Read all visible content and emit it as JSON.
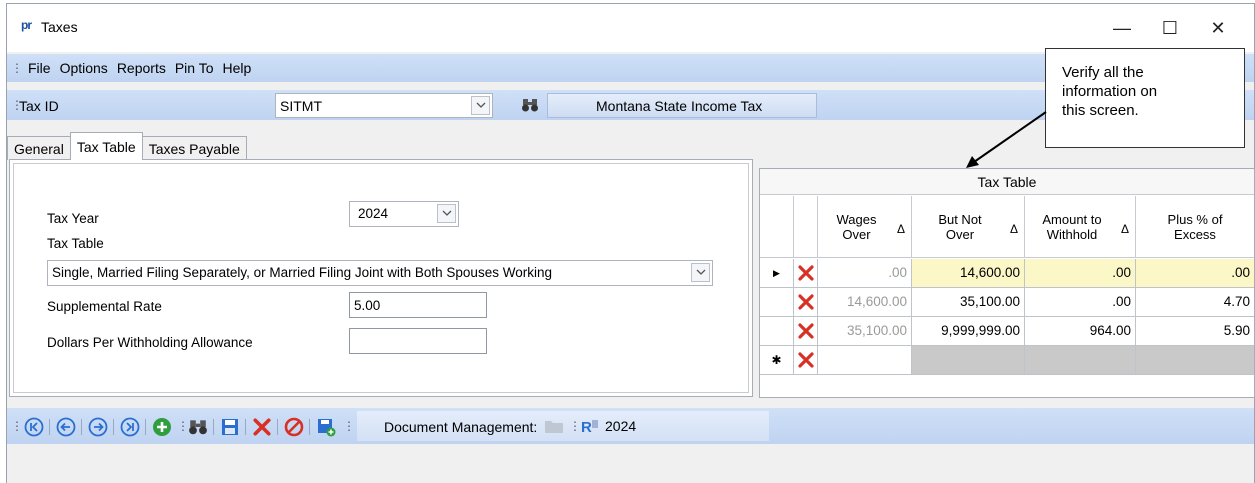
{
  "window": {
    "title": "Taxes",
    "logo": "pr",
    "minimize": "—",
    "maximize": "☐",
    "close": "✕"
  },
  "menu": [
    "File",
    "Options",
    "Reports",
    "Pin To",
    "Help"
  ],
  "tax_id": {
    "label": "Tax ID",
    "value": "SITMT",
    "description": "Montana State Income Tax"
  },
  "callout": {
    "line1": "Verify all the",
    "line2": "information on",
    "line3": "this screen."
  },
  "tabs": [
    "General",
    "Tax Table",
    "Taxes Payable"
  ],
  "active_tab": "Tax Table",
  "form": {
    "tax_year_label": "Tax Year",
    "tax_year_value": "2024",
    "tax_table_label": "Tax Table",
    "tax_table_value": "Single, Married Filing Separately, or Married Filing Joint with Both Spouses Working",
    "supplemental_rate_label": "Supplemental Rate",
    "supplemental_rate_value": "5.00",
    "dollars_allowance_label": "Dollars Per Withholding Allowance",
    "dollars_allowance_value": ""
  },
  "grid": {
    "title": "Tax Table",
    "columns": [
      {
        "line1": "Wages",
        "line2": "Over",
        "sort": "Δ"
      },
      {
        "line1": "But Not",
        "line2": "Over",
        "sort": "Δ"
      },
      {
        "line1": "Amount to",
        "line2": "Withhold",
        "sort": "Δ"
      },
      {
        "line1": "Plus % of",
        "line2": "Excess",
        "sort": ""
      }
    ],
    "rows": [
      {
        "wages_over": ".00",
        "but_not_over": "14,600.00",
        "amount": ".00",
        "percent": ".00"
      },
      {
        "wages_over": "14,600.00",
        "but_not_over": "35,100.00",
        "amount": ".00",
        "percent": "4.70"
      },
      {
        "wages_over": "35,100.00",
        "but_not_over": "9,999,999.00",
        "amount": "964.00",
        "percent": "5.90"
      }
    ],
    "current_row_marker": "▶",
    "new_row_marker": "✱"
  },
  "bottom": {
    "doc_label": "Document Management:",
    "year": "2024"
  },
  "colors": {
    "accent": "#c9dcf5",
    "delete_red": "#d93025",
    "nav_blue": "#2a6fd0",
    "add_green": "#2e9e3e",
    "highlight": "#fbf7c7"
  }
}
